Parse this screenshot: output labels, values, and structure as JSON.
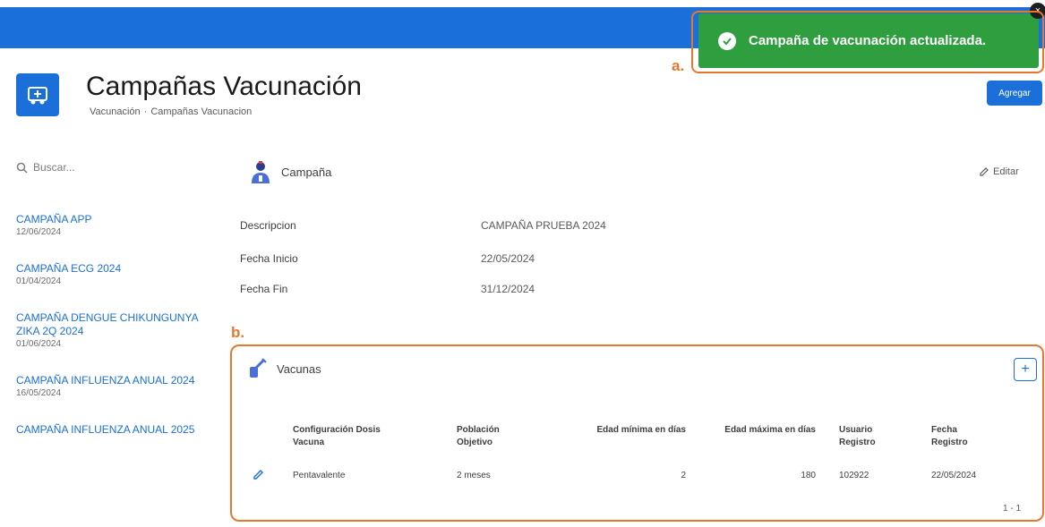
{
  "toast": {
    "message": "Campaña de vacunación actualizada.",
    "close": "×",
    "color": "#2e9e3e"
  },
  "header": {
    "title": "Campañas Vacunación",
    "breadcrumb": [
      "Vacunación",
      "Campañas Vacunacion"
    ],
    "add_label": "Agregar"
  },
  "sidebar": {
    "search_placeholder": "Buscar...",
    "items": [
      {
        "name": "CAMPAÑA APP",
        "date": "12/06/2024"
      },
      {
        "name": "CAMPAÑA ECG 2024",
        "date": "01/04/2024"
      },
      {
        "name": "CAMPAÑA DENGUE CHIKUNGUNYA ZIKA 2Q 2024",
        "date": "01/06/2024"
      },
      {
        "name": "CAMPAÑA INFLUENZA ANUAL 2024",
        "date": "16/05/2024"
      },
      {
        "name": "CAMPAÑA INFLUENZA ANUAL 2025",
        "date": ""
      }
    ]
  },
  "campaign": {
    "section_title": "Campaña",
    "edit_label": "Editar",
    "fields": [
      {
        "label": "Descripcion",
        "value": "CAMPAÑA PRUEBA 2024"
      },
      {
        "label": "Fecha Inicio",
        "value": "22/05/2024"
      },
      {
        "label": "Fecha Fin",
        "value": "31/12/2024"
      }
    ]
  },
  "vacunas": {
    "section_title": "Vacunas",
    "add_label": "+",
    "columns": [
      "Configuración Dosis Vacuna",
      "Población Objetivo",
      "Edad mínima en días",
      "Edad máxima en días",
      "Usuario Registro",
      "Fecha Registro"
    ],
    "rows": [
      [
        "Pentavalente",
        "2 meses",
        "2",
        "180",
        "102922",
        "22/05/2024"
      ]
    ],
    "pager": "1 - 1"
  },
  "markers": {
    "a": "a.",
    "b": "b."
  },
  "colors": {
    "accent": "#1b6fd8",
    "annotation": "#e8772e"
  }
}
